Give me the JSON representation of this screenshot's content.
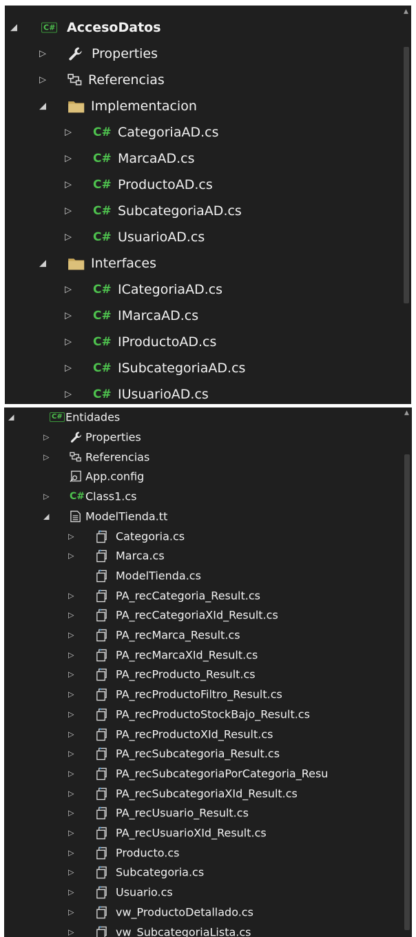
{
  "acceso_datos": {
    "root": "AccesoDatos",
    "items": [
      {
        "label": "Properties",
        "icon": "wrench-icon",
        "toggle": "collapsed"
      },
      {
        "label": "Referencias",
        "icon": "references-icon",
        "toggle": "collapsed"
      },
      {
        "label": "Implementacion",
        "icon": "folder-icon",
        "toggle": "expanded"
      },
      {
        "label": "CategoriaAD.cs",
        "icon": "csharp-file-icon",
        "toggle": "collapsed"
      },
      {
        "label": "MarcaAD.cs",
        "icon": "csharp-file-icon",
        "toggle": "collapsed"
      },
      {
        "label": "ProductoAD.cs",
        "icon": "csharp-file-icon",
        "toggle": "collapsed"
      },
      {
        "label": "SubcategoriaAD.cs",
        "icon": "csharp-file-icon",
        "toggle": "collapsed"
      },
      {
        "label": "UsuarioAD.cs",
        "icon": "csharp-file-icon",
        "toggle": "collapsed"
      },
      {
        "label": "Interfaces",
        "icon": "folder-icon",
        "toggle": "expanded"
      },
      {
        "label": "ICategoriaAD.cs",
        "icon": "csharp-file-icon",
        "toggle": "collapsed"
      },
      {
        "label": "IMarcaAD.cs",
        "icon": "csharp-file-icon",
        "toggle": "collapsed"
      },
      {
        "label": "IProductoAD.cs",
        "icon": "csharp-file-icon",
        "toggle": "collapsed"
      },
      {
        "label": "ISubcategoriaAD.cs",
        "icon": "csharp-file-icon",
        "toggle": "collapsed"
      },
      {
        "label": "IUsuarioAD.cs",
        "icon": "csharp-file-icon",
        "toggle": "collapsed"
      }
    ]
  },
  "entidades": {
    "root": "Entidades",
    "items": [
      {
        "label": "Properties",
        "icon": "wrench-icon",
        "toggle": "collapsed"
      },
      {
        "label": "Referencias",
        "icon": "references-icon",
        "toggle": "collapsed"
      },
      {
        "label": "App.config",
        "icon": "config-file-icon",
        "toggle": "none"
      },
      {
        "label": "Class1.cs",
        "icon": "csharp-file-icon",
        "toggle": "collapsed"
      },
      {
        "label": "ModelTienda.tt",
        "icon": "text-template-icon",
        "toggle": "expanded"
      },
      {
        "label": "Categoria.cs",
        "icon": "generated-file-icon",
        "toggle": "collapsed"
      },
      {
        "label": "Marca.cs",
        "icon": "generated-file-icon",
        "toggle": "collapsed"
      },
      {
        "label": "ModelTienda.cs",
        "icon": "generated-file-icon",
        "toggle": "none"
      },
      {
        "label": "PA_recCategoria_Result.cs",
        "icon": "generated-file-icon",
        "toggle": "collapsed"
      },
      {
        "label": "PA_recCategoriaXId_Result.cs",
        "icon": "generated-file-icon",
        "toggle": "collapsed"
      },
      {
        "label": "PA_recMarca_Result.cs",
        "icon": "generated-file-icon",
        "toggle": "collapsed"
      },
      {
        "label": "PA_recMarcaXId_Result.cs",
        "icon": "generated-file-icon",
        "toggle": "collapsed"
      },
      {
        "label": "PA_recProducto_Result.cs",
        "icon": "generated-file-icon",
        "toggle": "collapsed"
      },
      {
        "label": "PA_recProductoFiltro_Result.cs",
        "icon": "generated-file-icon",
        "toggle": "collapsed"
      },
      {
        "label": "PA_recProductoStockBajo_Result.cs",
        "icon": "generated-file-icon",
        "toggle": "collapsed"
      },
      {
        "label": "PA_recProductoXId_Result.cs",
        "icon": "generated-file-icon",
        "toggle": "collapsed"
      },
      {
        "label": "PA_recSubcategoria_Result.cs",
        "icon": "generated-file-icon",
        "toggle": "collapsed"
      },
      {
        "label": "PA_recSubcategoriaPorCategoria_Resu",
        "icon": "generated-file-icon",
        "toggle": "collapsed"
      },
      {
        "label": "PA_recSubcategoriaXId_Result.cs",
        "icon": "generated-file-icon",
        "toggle": "collapsed"
      },
      {
        "label": "PA_recUsuario_Result.cs",
        "icon": "generated-file-icon",
        "toggle": "collapsed"
      },
      {
        "label": "PA_recUsuarioXId_Result.cs",
        "icon": "generated-file-icon",
        "toggle": "collapsed"
      },
      {
        "label": "Producto.cs",
        "icon": "generated-file-icon",
        "toggle": "collapsed"
      },
      {
        "label": "Subcategoria.cs",
        "icon": "generated-file-icon",
        "toggle": "collapsed"
      },
      {
        "label": "Usuario.cs",
        "icon": "generated-file-icon",
        "toggle": "collapsed"
      },
      {
        "label": "vw_ProductoDetallado.cs",
        "icon": "generated-file-icon",
        "toggle": "collapsed"
      },
      {
        "label": "vw_SubcategoriaLista.cs",
        "icon": "generated-file-icon",
        "toggle": "collapsed"
      }
    ]
  },
  "icons": {
    "csharp_glyph": "C#",
    "project_badge": "C#"
  },
  "colors": {
    "background": "#1f1f1f",
    "text": "#f2f2f2",
    "csharp_green": "#4ec24e",
    "folder": "#c9a85a"
  }
}
